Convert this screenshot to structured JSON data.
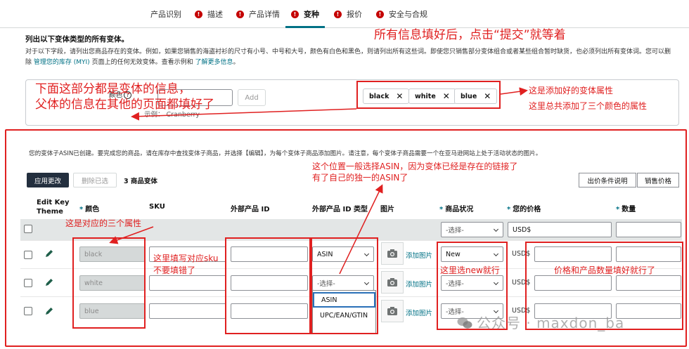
{
  "tabs": [
    {
      "label": "产品识别",
      "error": false
    },
    {
      "label": "描述",
      "error": true
    },
    {
      "label": "产品详情",
      "error": true
    },
    {
      "label": "变种",
      "error": true,
      "active": true
    },
    {
      "label": "报价",
      "error": true
    },
    {
      "label": "安全与合规",
      "error": true
    }
  ],
  "section_title": "列出以下变体类型的所有变体。",
  "intro": {
    "line1": "对于以下字段，请列出您商品存在的变体。例如，如果您销售的海盗衬衫的尺寸有小号、中号和大号，颜色有白色和黑色，则请列出所有这些词。即使您只销售部分变体组合或者某些组合暂时缺货，也必须列出所有变体词。您可以删",
    "line2_pre": "除",
    "manage_link": "管理您的库存 (MYI)",
    "line2_mid": "页面上的任何无效变体。查看示例和",
    "learn_link": "了解更多信息",
    "line2_end": "。"
  },
  "color_attr": {
    "label": "颜色",
    "help": "?",
    "add_label": "Add",
    "example": "示例： Cranberry",
    "chips": [
      "black",
      "white",
      "blue"
    ],
    "remove_glyph": "✕"
  },
  "child_note": "您的变体子ASIN已创建。要完成您的商品，请在库存中查找变体子商品，并选择【编辑】，为每个变体子商品添加图片。请注意，每个变体子商品需要一个在亚马逊网站上处于活动状态的图片。",
  "toolbar": {
    "apply": "应用更改",
    "delete": "删除已选",
    "count": "3 商品变体",
    "condition_btn": "出价条件说明",
    "sale_price_btn": "销售价格"
  },
  "table": {
    "headers": {
      "edit": "Edit Key Theme",
      "color": "颜色",
      "sku": "SKU",
      "ext_id": "外部产品 ID",
      "ext_id_type": "外部产品 ID 类型",
      "image": "图片",
      "condition": "商品状况",
      "price": "您的价格",
      "quantity": "数量"
    },
    "required_mark": "*",
    "bulk_row": {
      "condition": "-选择-",
      "currency": "USD$"
    },
    "rows": [
      {
        "color": "black",
        "id_type": "ASIN",
        "condition": "New",
        "currency": "USD$"
      },
      {
        "color": "white",
        "id_type": "-选择-",
        "condition": "-选择-",
        "currency": "USD$"
      },
      {
        "color": "blue",
        "id_type": "",
        "condition": "-选择-",
        "currency": "USD$"
      }
    ],
    "add_image": "添加图片",
    "dropdown_options": [
      "ASIN",
      "UPC/EAN/GTIN"
    ]
  },
  "annotations": {
    "submit": "所有信息填好后，点击“提交”就等着",
    "variant_info_1": "下面这部分都是变体的信息，",
    "variant_info_2": "父体的信息在其他的页面都填好了",
    "added_attr": "这是添加好的变体属性",
    "three_colors": "这里总共添加了三个颜色的属性",
    "asin_1": "这个位置一般选择ASIN，因为变体已经是存在的链接了",
    "asin_2": "有了自己的独一的ASIN了",
    "corresponding": "这是对应的三个属性",
    "sku_1": "这里填写对应sku",
    "sku_2": "不要填错了",
    "condition": "这里选new就行",
    "price_qty": "价格和产品数量填好就行了"
  },
  "watermark": "公众号 · maxdon_ba",
  "colors": {
    "annotation": "#e02020",
    "link": "#007185",
    "active_tab": "#007185",
    "error_icon": "#c40000",
    "apply_btn": "#232f3e"
  }
}
